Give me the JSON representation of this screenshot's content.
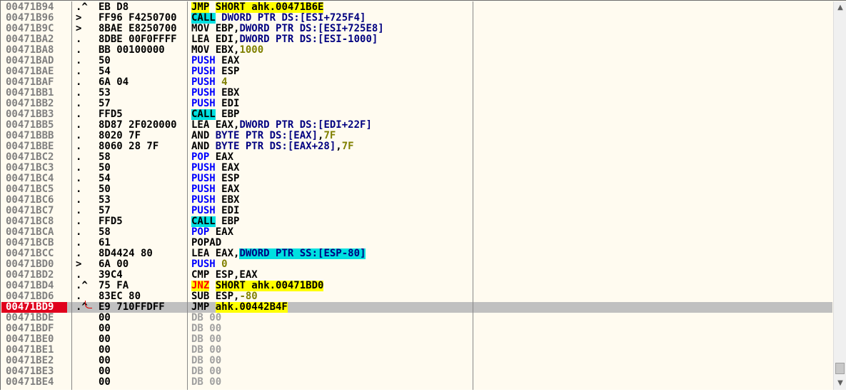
{
  "scroll": {
    "up_arrow": "▲",
    "down_arrow": "▼"
  },
  "rows": [
    {
      "addr": "00471B94",
      "mark": ".^",
      "hex": "EB D8",
      "dis": [
        [
          "jmp",
          "JMP"
        ],
        [
          "plain",
          " "
        ],
        [
          "jmp",
          "SHORT ahk.00471B6E"
        ]
      ]
    },
    {
      "addr": "00471B96",
      "mark": ">",
      "hex": "FF96 F4250700",
      "dis": [
        [
          "call",
          "CALL"
        ],
        [
          "plain",
          " "
        ],
        [
          "mem",
          "DWORD PTR DS:[ESI+725F4]"
        ]
      ]
    },
    {
      "addr": "00471B9C",
      "mark": ">",
      "hex": "8BAE E8250700",
      "dis": [
        [
          "plain",
          "MOV EBP,"
        ],
        [
          "mem",
          "DWORD PTR DS:[ESI+725E8]"
        ]
      ]
    },
    {
      "addr": "00471BA2",
      "mark": ".",
      "hex": "8DBE 00F0FFFF",
      "dis": [
        [
          "plain",
          "LEA EDI,"
        ],
        [
          "mem",
          "DWORD PTR DS:[ESI-1000]"
        ]
      ]
    },
    {
      "addr": "00471BA8",
      "mark": ".",
      "hex": "BB 00100000",
      "dis": [
        [
          "plain",
          "MOV EBX,"
        ],
        [
          "num",
          "1000"
        ]
      ]
    },
    {
      "addr": "00471BAD",
      "mark": ".",
      "hex": "50",
      "dis": [
        [
          "push",
          "PUSH"
        ],
        [
          "plain",
          " EAX"
        ]
      ]
    },
    {
      "addr": "00471BAE",
      "mark": ".",
      "hex": "54",
      "dis": [
        [
          "push",
          "PUSH"
        ],
        [
          "plain",
          " ESP"
        ]
      ]
    },
    {
      "addr": "00471BAF",
      "mark": ".",
      "hex": "6A 04",
      "dis": [
        [
          "push",
          "PUSH"
        ],
        [
          "plain",
          " "
        ],
        [
          "num",
          "4"
        ]
      ]
    },
    {
      "addr": "00471BB1",
      "mark": ".",
      "hex": "53",
      "dis": [
        [
          "push",
          "PUSH"
        ],
        [
          "plain",
          " EBX"
        ]
      ]
    },
    {
      "addr": "00471BB2",
      "mark": ".",
      "hex": "57",
      "dis": [
        [
          "push",
          "PUSH"
        ],
        [
          "plain",
          " EDI"
        ]
      ]
    },
    {
      "addr": "00471BB3",
      "mark": ".",
      "hex": "FFD5",
      "dis": [
        [
          "call",
          "CALL"
        ],
        [
          "plain",
          " EBP"
        ]
      ]
    },
    {
      "addr": "00471BB5",
      "mark": ".",
      "hex": "8D87 2F020000",
      "dis": [
        [
          "plain",
          "LEA EAX,"
        ],
        [
          "mem",
          "DWORD PTR DS:[EDI+22F]"
        ]
      ]
    },
    {
      "addr": "00471BBB",
      "mark": ".",
      "hex": "8020 7F",
      "dis": [
        [
          "plain",
          "AND "
        ],
        [
          "mem",
          "BYTE PTR DS:[EAX]"
        ],
        [
          "plain",
          ","
        ],
        [
          "num",
          "7F"
        ]
      ]
    },
    {
      "addr": "00471BBE",
      "mark": ".",
      "hex": "8060 28 7F",
      "dis": [
        [
          "plain",
          "AND "
        ],
        [
          "mem",
          "BYTE PTR DS:[EAX+28]"
        ],
        [
          "plain",
          ","
        ],
        [
          "num",
          "7F"
        ]
      ]
    },
    {
      "addr": "00471BC2",
      "mark": ".",
      "hex": "58",
      "dis": [
        [
          "push",
          "POP"
        ],
        [
          "plain",
          " EAX"
        ]
      ]
    },
    {
      "addr": "00471BC3",
      "mark": ".",
      "hex": "50",
      "dis": [
        [
          "push",
          "PUSH"
        ],
        [
          "plain",
          " EAX"
        ]
      ]
    },
    {
      "addr": "00471BC4",
      "mark": ".",
      "hex": "54",
      "dis": [
        [
          "push",
          "PUSH"
        ],
        [
          "plain",
          " ESP"
        ]
      ]
    },
    {
      "addr": "00471BC5",
      "mark": ".",
      "hex": "50",
      "dis": [
        [
          "push",
          "PUSH"
        ],
        [
          "plain",
          " EAX"
        ]
      ]
    },
    {
      "addr": "00471BC6",
      "mark": ".",
      "hex": "53",
      "dis": [
        [
          "push",
          "PUSH"
        ],
        [
          "plain",
          " EBX"
        ]
      ]
    },
    {
      "addr": "00471BC7",
      "mark": ".",
      "hex": "57",
      "dis": [
        [
          "push",
          "PUSH"
        ],
        [
          "plain",
          " EDI"
        ]
      ]
    },
    {
      "addr": "00471BC8",
      "mark": ".",
      "hex": "FFD5",
      "dis": [
        [
          "call",
          "CALL"
        ],
        [
          "plain",
          " EBP"
        ]
      ]
    },
    {
      "addr": "00471BCA",
      "mark": ".",
      "hex": "58",
      "dis": [
        [
          "push",
          "POP"
        ],
        [
          "plain",
          " EAX"
        ]
      ]
    },
    {
      "addr": "00471BCB",
      "mark": ".",
      "hex": "61",
      "dis": [
        [
          "plain",
          "POPAD"
        ]
      ]
    },
    {
      "addr": "00471BCC",
      "mark": ".",
      "hex": "8D4424 80",
      "dis": [
        [
          "plain",
          "LEA EAX,"
        ],
        [
          "hl",
          "DWORD PTR SS:[ESP-80]"
        ]
      ]
    },
    {
      "addr": "00471BD0",
      "mark": ">",
      "hex": "6A 00",
      "dis": [
        [
          "push",
          "PUSH"
        ],
        [
          "plain",
          " "
        ],
        [
          "num",
          "0"
        ]
      ]
    },
    {
      "addr": "00471BD2",
      "mark": ".",
      "hex": "39C4",
      "dis": [
        [
          "plain",
          "CMP ESP,EAX"
        ]
      ]
    },
    {
      "addr": "00471BD4",
      "mark": ".^",
      "hex": "75 FA",
      "dis": [
        [
          "jcc",
          "JNZ"
        ],
        [
          "plain",
          " "
        ],
        [
          "jmp",
          "SHORT ahk.00471BD0"
        ]
      ]
    },
    {
      "addr": "00471BD6",
      "mark": ".",
      "hex": "83EC 80",
      "dis": [
        [
          "plain",
          "SUB ESP,"
        ],
        [
          "num",
          "-80"
        ]
      ]
    },
    {
      "addr": "00471BD9",
      "mark": ".^",
      "hex": "E9 710FFDFF",
      "dis": [
        [
          "plain",
          "JMP "
        ],
        [
          "jmp",
          "ahk.00442B4F"
        ]
      ],
      "selected": true
    },
    {
      "addr": "00471BDE",
      "mark": "",
      "hex": "00",
      "dis": [
        [
          "db",
          "DB 00"
        ]
      ]
    },
    {
      "addr": "00471BDF",
      "mark": "",
      "hex": "00",
      "dis": [
        [
          "db",
          "DB 00"
        ]
      ]
    },
    {
      "addr": "00471BE0",
      "mark": "",
      "hex": "00",
      "dis": [
        [
          "db",
          "DB 00"
        ]
      ]
    },
    {
      "addr": "00471BE1",
      "mark": "",
      "hex": "00",
      "dis": [
        [
          "db",
          "DB 00"
        ]
      ]
    },
    {
      "addr": "00471BE2",
      "mark": "",
      "hex": "00",
      "dis": [
        [
          "db",
          "DB 00"
        ]
      ]
    },
    {
      "addr": "00471BE3",
      "mark": "",
      "hex": "00",
      "dis": [
        [
          "db",
          "DB 00"
        ]
      ]
    },
    {
      "addr": "00471BE4",
      "mark": "",
      "hex": "00",
      "dis": [
        [
          "db",
          "DB 00"
        ]
      ]
    }
  ]
}
